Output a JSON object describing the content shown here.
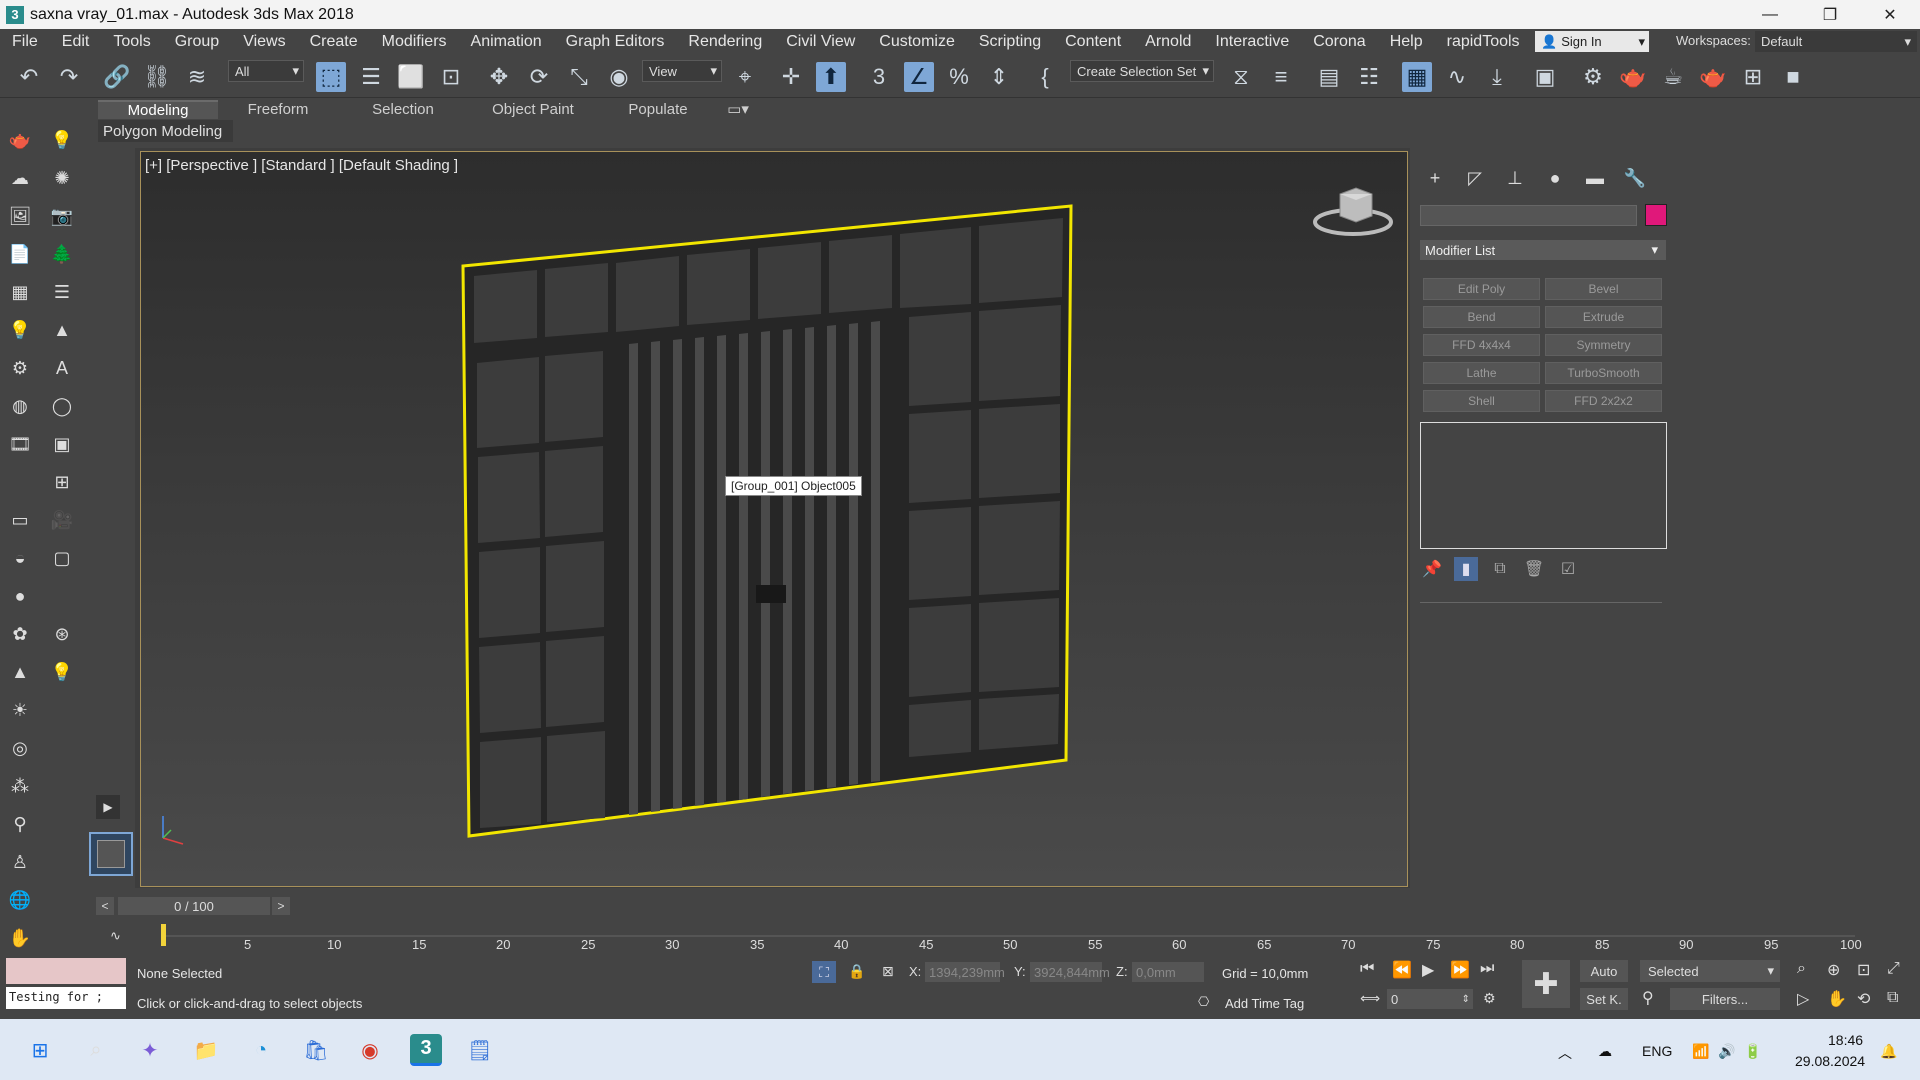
{
  "window": {
    "title": "saxna vray_01.max - Autodesk 3ds Max 2018",
    "app_icon": "3",
    "minimize": "—",
    "maximize": "❐",
    "close": "✕"
  },
  "menu": [
    "File",
    "Edit",
    "Tools",
    "Group",
    "Views",
    "Create",
    "Modifiers",
    "Animation",
    "Graph Editors",
    "Rendering",
    "Civil View",
    "Customize",
    "Scripting",
    "Content",
    "Arnold",
    "Interactive",
    "Corona",
    "Help",
    "rapidTools"
  ],
  "signin": {
    "label": "Sign In"
  },
  "workspaces": {
    "label": "Workspaces:",
    "value": "Default"
  },
  "toolbar": {
    "selection_filter": "All",
    "ref_coord": "View",
    "selection_set": "Create Selection Set"
  },
  "ribbon": {
    "tabs": [
      "Modeling",
      "Freeform",
      "Selection",
      "Object Paint",
      "Populate"
    ],
    "active_tab": "Modeling",
    "subpanel": "Polygon Modeling"
  },
  "viewport": {
    "label": "[+] [Perspective ] [Standard ] [Default Shading ]",
    "tooltip": "[Group_001] Object005",
    "selection_color": "#f2e600",
    "object_color": "#222222"
  },
  "command_panel": {
    "modifier_list": "Modifier List",
    "object_color": "#e0187a",
    "modifiers": [
      "Edit Poly",
      "Bevel",
      "Bend",
      "Extrude",
      "FFD 4x4x4",
      "Symmetry",
      "Lathe",
      "TurboSmooth",
      "Shell",
      "FFD 2x2x2"
    ]
  },
  "timeline": {
    "frame_display": "0 / 100",
    "ticks": [
      "5",
      "10",
      "15",
      "20",
      "25",
      "30",
      "35",
      "40",
      "45",
      "50",
      "55",
      "60",
      "65",
      "70",
      "75",
      "80",
      "85",
      "90",
      "95",
      "100"
    ]
  },
  "status": {
    "maxscript_text": "Testing for ;",
    "selection": "None Selected",
    "prompt": "Click or click-and-drag to select objects",
    "x_label": "X:",
    "x_value": "1394,239mm",
    "y_label": "Y:",
    "y_value": "3924,844mm",
    "z_label": "Z:",
    "z_value": "0,0mm",
    "grid": "Grid = 10,0mm",
    "add_time_tag": "Add Time Tag",
    "auto": "Auto",
    "setk": "Set K.",
    "key_mode": "Selected",
    "filters": "Filters...",
    "frame_value": "0"
  },
  "taskbar": {
    "lang": "ENG",
    "time": "18:46",
    "date": "29.08.2024"
  }
}
